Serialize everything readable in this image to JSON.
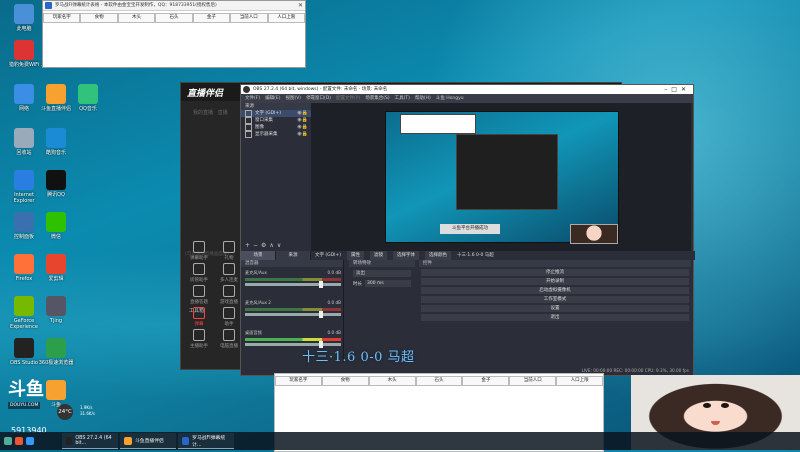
{
  "desktop_icons": [
    {
      "label": "此电脑",
      "color": "#4a90d9"
    },
    {
      "label": "斗鱼直播...",
      "color": "#3b6cd9"
    },
    {
      "label": "猎豹免费WiFi",
      "color": "#d33"
    },
    {
      "label": "斗鱼直播助手",
      "color": "#f7a230"
    },
    {
      "label": "网络",
      "color": "#3a8ee6"
    },
    {
      "label": "斗鱼直播伴侣",
      "color": "#f7a230"
    },
    {
      "label": "QQ音乐",
      "color": "#31c27c"
    },
    {
      "label": "回收站",
      "color": "#9ab"
    },
    {
      "label": "酷狗音乐",
      "color": "#1b8bd6"
    },
    {
      "label": "Internet Explorer",
      "color": "#2a7de1"
    },
    {
      "label": "腾讯QQ",
      "color": "#111"
    },
    {
      "label": "控制面板",
      "color": "#3a6fb0"
    },
    {
      "label": "微信",
      "color": "#2dc100"
    },
    {
      "label": "Firefox",
      "color": "#ff7139"
    },
    {
      "label": "爱剪辑",
      "color": "#e8452f"
    },
    {
      "label": "GeForce Experience",
      "color": "#76b900"
    },
    {
      "label": "Tjing",
      "color": "#556"
    },
    {
      "label": "OBS Studio",
      "color": "#222"
    },
    {
      "label": "360极速浏览器",
      "color": "#2b9f4c"
    },
    {
      "label": "斗鱼",
      "color": "#f7a230"
    }
  ],
  "sheet_top": {
    "title": "罗马战FI弹幕统计表格 - 本软件由金宝宝开发制作，QQ：918733951(授权售后)",
    "columns": [
      "玩家名字",
      "食物",
      "木头",
      "石头",
      "金子",
      "当前人口",
      "人口上限"
    ]
  },
  "zhibo": {
    "logo": "直播伴侣",
    "tab1": "我的直播",
    "tab2": "直播",
    "placeholder": "(可以添加直播画面源)",
    "tools_label": "工具箱",
    "tools": [
      {
        "label": "弹幕助手"
      },
      {
        "label": "礼物"
      },
      {
        "label": "房管助手"
      },
      {
        "label": "多人连麦"
      },
      {
        "label": "直播答题"
      },
      {
        "label": "游戏直播"
      },
      {
        "label": "弹幕"
      },
      {
        "label": "助手"
      },
      {
        "label": "主播助手"
      },
      {
        "label": "电脑直播"
      }
    ]
  },
  "obs": {
    "title": "OBS 27.2.4 (64 bit, windows) - 配置文件: 未命名 - 场景: 未命名",
    "menu": [
      "文件(F)",
      "编辑(E)",
      "视图(V)",
      "停靠窗口(D)",
      "配置文件(P)",
      "场景集合(S)",
      "工具(T)",
      "帮助(H)",
      "斗鱼 Hongyu"
    ],
    "sources_header": "来源",
    "sources": [
      "文字 (GDI+)",
      "窗口采集",
      "图像",
      "显示器采集"
    ],
    "docktabs": [
      "场景",
      "来源"
    ],
    "propbar": {
      "text_src": "文字 (GDI+)",
      "props": "属性",
      "filters": "滤镜",
      "select": "选择字体",
      "restore": "选择颜色",
      "current": "十三·1.6 0-0 马超"
    },
    "mixer_header": "混音器",
    "trans_header": "转场特效",
    "controls_header": "控件",
    "mixer": [
      {
        "name": "麦克风/Aux",
        "db": "0.0 dB"
      },
      {
        "name": "麦克风/Aux 2",
        "db": "0.0 dB"
      },
      {
        "name": "桌面音频",
        "db": "0.0 dB"
      }
    ],
    "trans_select": "淡出",
    "duration_label": "时长",
    "duration_value": "300 ms",
    "controls": [
      "停止推流",
      "开始录制",
      "启动虚拟摄像机",
      "工作室模式",
      "设置",
      "退出"
    ],
    "toast": "斗鱼平台开播成功",
    "status": "LIVE: 00:00:00   REC: 00:00:00   CPU: 9.3%, 30.00 fps"
  },
  "overlay_text": "十三·1.6 0-0 马超",
  "sheet_bottom": {
    "columns": [
      "玩家名字",
      "食物",
      "木头",
      "石头",
      "金子",
      "当前人口",
      "人口上限"
    ]
  },
  "douyu": {
    "logo": "斗鱼",
    "sub": "DOUYU.COM",
    "counter": "5913940",
    "temp": "24°C",
    "speed_up": "1.9K/s",
    "speed_down": "31.6K/s"
  },
  "taskbar": [
    {
      "label": "OBS 27.2.4 (64 bit...",
      "color": "#222"
    },
    {
      "label": "斗鱼直播伴侣",
      "color": "#f7a230"
    },
    {
      "label": "罗马战FI弹幕统计...",
      "color": "#2a66c9"
    }
  ]
}
